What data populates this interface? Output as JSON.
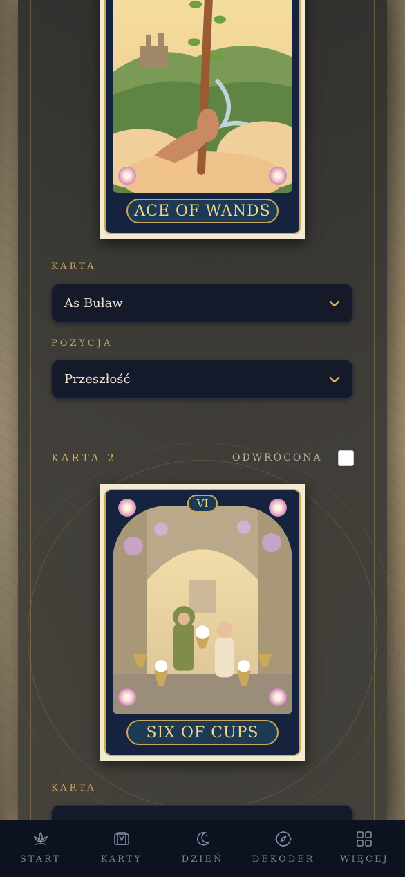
{
  "cards": [
    {
      "name_en": "ACE OF WANDS",
      "field_label_card": "KARTA",
      "card_value": "As Buław",
      "field_label_position": "POZYCJA",
      "position_value": "Przeszłość"
    },
    {
      "section_title": "KARTA 2",
      "reversed_label": "ODWRÓCONA",
      "numeral": "VI",
      "name_en": "SIX OF CUPS",
      "field_label_card": "KARTA"
    }
  ],
  "nav": [
    {
      "label": "START",
      "icon": "lotus-icon"
    },
    {
      "label": "KARTY",
      "icon": "cards-icon"
    },
    {
      "label": "DZIEŃ",
      "icon": "moon-icon"
    },
    {
      "label": "DEKODER",
      "icon": "compass-icon"
    },
    {
      "label": "WIĘCEJ",
      "icon": "grid-icon"
    }
  ],
  "colors": {
    "accent_gold": "#c9a85c",
    "select_bg": "#151a2a",
    "nav_bg": "#0d1220"
  }
}
